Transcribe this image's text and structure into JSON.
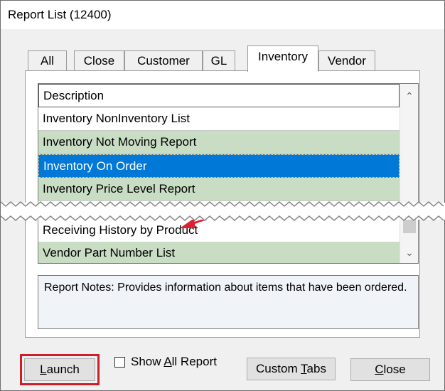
{
  "window": {
    "title": "Report List (12400)"
  },
  "tabs": [
    {
      "label": "All"
    },
    {
      "label": "Close"
    },
    {
      "label": "Customer"
    },
    {
      "label": "GL"
    },
    {
      "label": "Inventory"
    },
    {
      "label": "Vendor"
    }
  ],
  "list": {
    "header": "Description",
    "rows": [
      {
        "label": "Inventory NonInventory List"
      },
      {
        "label": "Inventory Not Moving Report"
      },
      {
        "label": "Inventory On Order",
        "selected": true
      },
      {
        "label": "Inventory Price Level Report"
      },
      {
        "label": "Receiving History by Product"
      },
      {
        "label": "Vendor Part Number List"
      }
    ]
  },
  "notes": {
    "text": "Report Notes:  Provides information about items that have been ordered."
  },
  "buttons": {
    "launch_pre": "",
    "launch_ul": "L",
    "launch_post": "aunch",
    "showall_pre": "Show ",
    "showall_ul": "A",
    "showall_post": "ll Report",
    "custom_pre": "Custom ",
    "custom_ul": "T",
    "custom_post": "abs",
    "close_pre": "",
    "close_ul": "C",
    "close_post": "lose"
  },
  "colors": {
    "selection": "#0078d7",
    "green_row": "#c8ddc4",
    "highlight_frame": "#cc1f2b",
    "callout_arrow": "#e0202f"
  }
}
